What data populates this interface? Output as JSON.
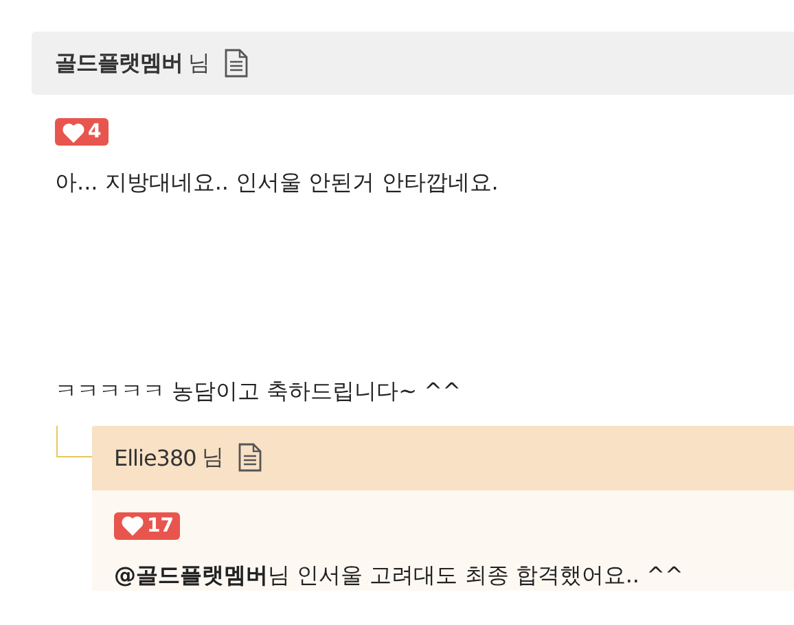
{
  "comments": [
    {
      "author": "골드플랫멤버",
      "suffix": "님",
      "likes": "4",
      "paragraphs": [
        "아... 지방대네요.. 인서울 안된거 안타깝네요.",
        "ㅋㅋㅋㅋㅋ 농담이고 축하드립니다~ ^^"
      ],
      "replies": [
        {
          "author": "Ellie380",
          "suffix": "님",
          "likes": "17",
          "paragraphs": [
            "**@골드플랫멤버**님 인서울 고려대도 최종 합격했어요.. ^^"
          ]
        }
      ]
    }
  ]
}
